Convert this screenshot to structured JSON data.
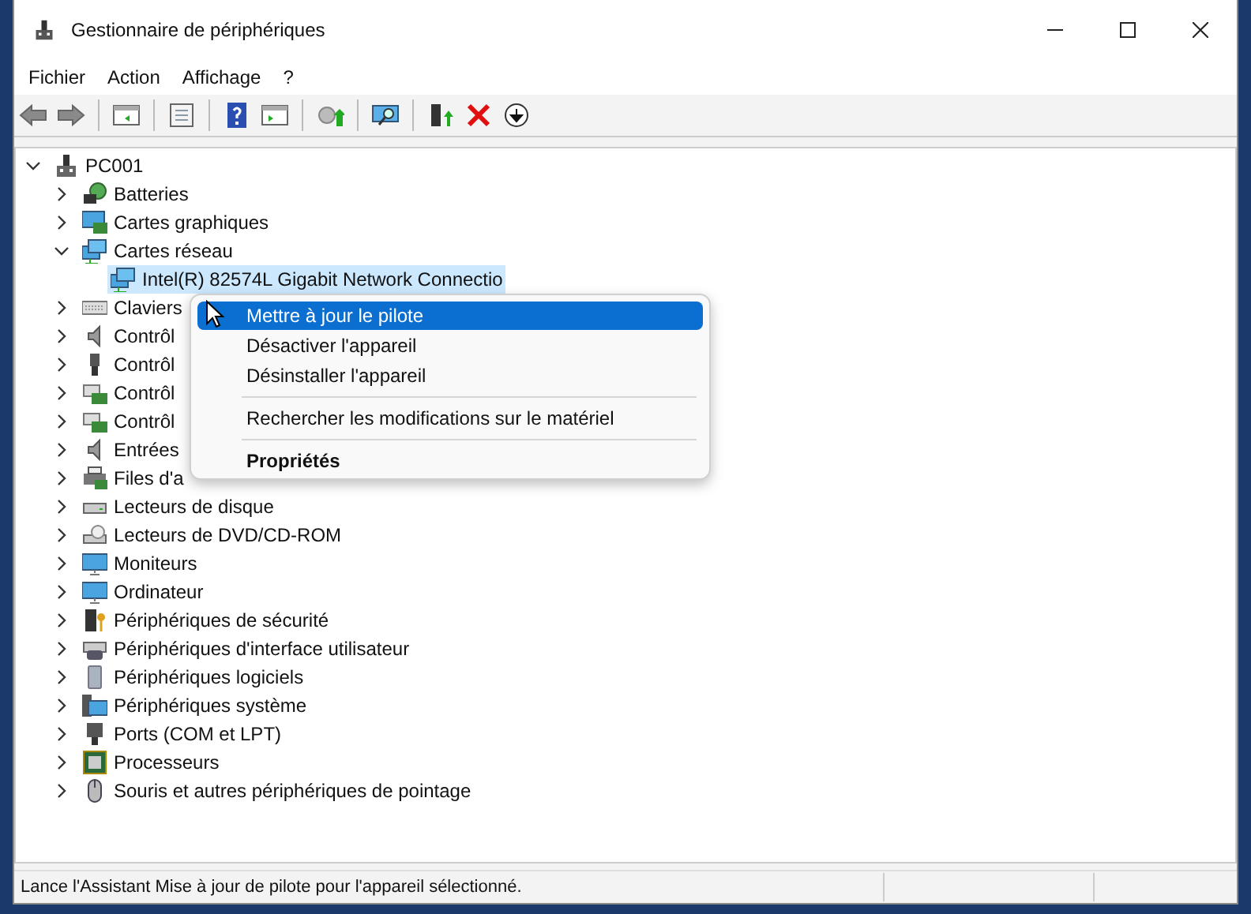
{
  "window": {
    "title": "Gestionnaire de périphériques"
  },
  "menu": [
    "Fichier",
    "Action",
    "Affichage",
    "?"
  ],
  "tree": [
    {
      "label": "PC001",
      "expanded": true,
      "selected": false,
      "children": [
        {
          "label": "Batteries",
          "expanded": false,
          "selected": false
        },
        {
          "label": "Cartes graphiques",
          "expanded": false,
          "selected": false
        },
        {
          "label": "Cartes réseau",
          "expanded": true,
          "selected": false,
          "children": [
            {
              "label": "Intel(R) 82574L Gigabit Network Connectio",
              "selected": true
            }
          ]
        },
        {
          "label": "Claviers",
          "expanded": false,
          "selected": false
        },
        {
          "label": "Contrôl",
          "expanded": false,
          "selected": false
        },
        {
          "label": "Contrôl",
          "expanded": false,
          "selected": false
        },
        {
          "label": "Contrôl",
          "expanded": false,
          "selected": false
        },
        {
          "label": "Contrôl",
          "expanded": false,
          "selected": false
        },
        {
          "label": "Entrées",
          "expanded": false,
          "selected": false
        },
        {
          "label": "Files d'a",
          "expanded": false,
          "selected": false
        },
        {
          "label": "Lecteurs de disque",
          "expanded": false,
          "selected": false
        },
        {
          "label": "Lecteurs de DVD/CD-ROM",
          "expanded": false,
          "selected": false
        },
        {
          "label": "Moniteurs",
          "expanded": false,
          "selected": false
        },
        {
          "label": "Ordinateur",
          "expanded": false,
          "selected": false
        },
        {
          "label": "Périphériques de sécurité",
          "expanded": false,
          "selected": false
        },
        {
          "label": "Périphériques d'interface utilisateur",
          "expanded": false,
          "selected": false
        },
        {
          "label": "Périphériques logiciels",
          "expanded": false,
          "selected": false
        },
        {
          "label": "Périphériques système",
          "expanded": false,
          "selected": false
        },
        {
          "label": "Ports (COM et LPT)",
          "expanded": false,
          "selected": false
        },
        {
          "label": "Processeurs",
          "expanded": false,
          "selected": false
        },
        {
          "label": "Souris et autres périphériques de pointage",
          "expanded": false,
          "selected": false
        }
      ]
    }
  ],
  "context_menu": [
    {
      "kind": "item",
      "label": "Mettre à jour le pilote",
      "selected": true,
      "bold": false
    },
    {
      "kind": "item",
      "label": "Désactiver l'appareil",
      "selected": false,
      "bold": false
    },
    {
      "kind": "item",
      "label": "Désinstaller l'appareil",
      "selected": false,
      "bold": false
    },
    {
      "kind": "separator"
    },
    {
      "kind": "item",
      "label": "Rechercher les modifications sur le matériel",
      "selected": false,
      "bold": false
    },
    {
      "kind": "separator"
    },
    {
      "kind": "item",
      "label": "Propriétés",
      "selected": false,
      "bold": true
    }
  ],
  "status_bar": "Lance l'Assistant Mise à jour de pilote pour l'appareil sélectionné."
}
